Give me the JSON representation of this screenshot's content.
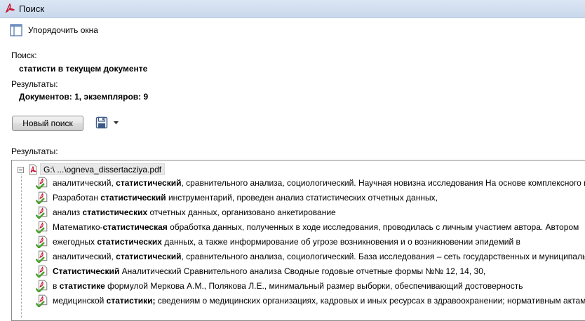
{
  "window": {
    "title": "Поиск"
  },
  "toolbar": {
    "arrange_label": "Упорядочить окна"
  },
  "search": {
    "label": "Поиск:",
    "query": "статисти в текущем документе"
  },
  "summary": {
    "label": "Результаты:",
    "value": "Документов: 1, экземпляров: 9"
  },
  "actions": {
    "new_search_label": "Новый поиск"
  },
  "results": {
    "label": "Результаты:",
    "file": "G:\\ ...\\ogneva_dissertacziya.pdf",
    "items": [
      {
        "pre": "аналитический, ",
        "match": "статистический",
        "post": ", сравнительного анализа, социологический. Научная новизна исследования На основе комплексного и"
      },
      {
        "pre": "Разработан ",
        "match": "статистический",
        "post": " инструментарий, проведен анализ статистических отчетных данных,"
      },
      {
        "pre": "анализ ",
        "match": "статистических",
        "post": " отчетных данных, организовано анкетирование"
      },
      {
        "pre": "Математико-",
        "match": "статистическая",
        "post": " обработка данных, полученных в ходе исследования, проводилась с личным участием автора. Автором"
      },
      {
        "pre": "ежегодных ",
        "match": "статистических",
        "post": " данных, а также информирование об угрозе возникновения и о возникновении эпидемий в"
      },
      {
        "pre": "аналитический, ",
        "match": "статистический",
        "post": ", сравнительного анализа, социологический. База исследования – сеть государственных и муниципальн"
      },
      {
        "pre": "",
        "match": "Статистический",
        "post": " Аналитический Сравнительного анализа Сводные годовые отчетные формы №№ 12, 14, 30,"
      },
      {
        "pre": "в ",
        "match": "статистике",
        "post": " формулой Меркова А.М., Полякова Л.Е., минимальный размер выборки, обеспечивающий достоверность"
      },
      {
        "pre": "медицинской ",
        "match": "статистики;",
        "post": " сведениям о медицинских организациях, кадровых и иных ресурсах в здравоохранении; нормативным актам, ф"
      }
    ]
  },
  "colors": {
    "accent": "#c8102e",
    "check": "#4aa02c",
    "titlebar": "#c9d8ec"
  },
  "icons": {
    "app": "pdf-icon",
    "arrange": "tile-windows-icon",
    "save": "floppy-disk-icon",
    "dropdown": "chevron-down-icon",
    "file": "pdf-file-icon",
    "result": "pdf-check-icon"
  }
}
